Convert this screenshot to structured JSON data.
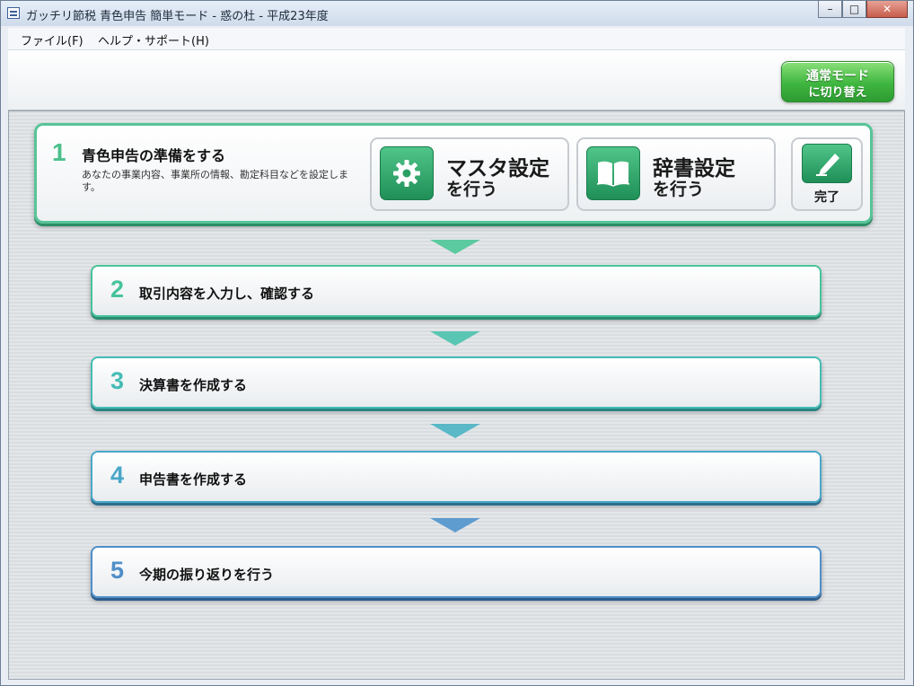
{
  "window": {
    "title": "ガッチリ節税 青色申告 簡単モード - 惑の杜 - 平成23年度"
  },
  "menu": [
    {
      "label": "ファイル(F)"
    },
    {
      "label": "ヘルプ・サポート(H)"
    }
  ],
  "mode_switch": {
    "line1": "通常モード",
    "line2": "に切り替え"
  },
  "step1": {
    "number": "1",
    "title": "青色申告の準備をする",
    "description": "あなたの事業内容、事業所の情報、勘定科目などを設定します。",
    "buttons": {
      "master": {
        "line1": "マスタ設定",
        "line2": "を行う",
        "icon": "gear-icon"
      },
      "dictionary": {
        "line1": "辞書設定",
        "line2": "を行う",
        "icon": "book-icon"
      },
      "done": {
        "label": "完了",
        "icon": "pencil-icon"
      }
    }
  },
  "steps": [
    {
      "number": "2",
      "label": "取引内容を入力し、確認する",
      "color": "#47c39a"
    },
    {
      "number": "3",
      "label": "決算書を作成する",
      "color": "#45bcb5"
    },
    {
      "number": "4",
      "label": "申告書を作成する",
      "color": "#4aa7c8"
    },
    {
      "number": "5",
      "label": "今期の振り返りを行う",
      "color": "#4f8fc9"
    }
  ],
  "colors": {
    "accent_green": "#4cc08c",
    "mode_button": "#3fb63f"
  }
}
